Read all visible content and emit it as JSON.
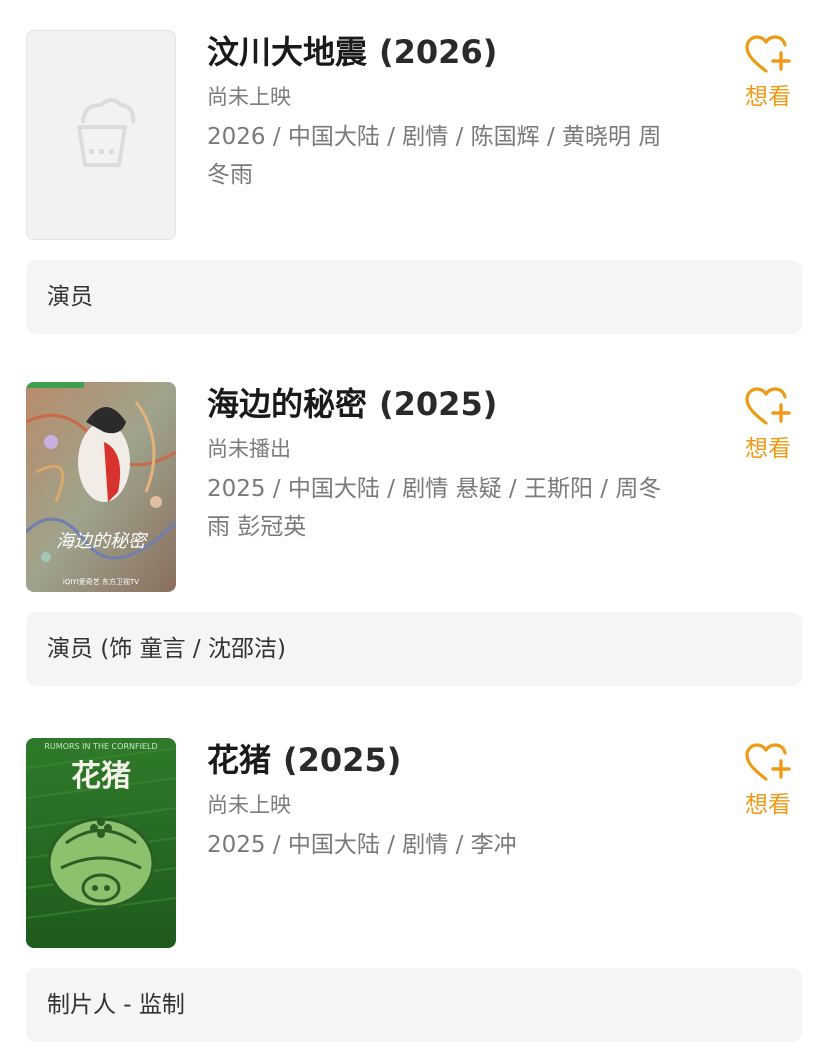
{
  "movies": [
    {
      "title": "汶川大地震",
      "year": "(2026)",
      "status": "尚未上映",
      "meta": "2026 / 中国大陆 / 剧情 / 陈国辉 / 黄晓明 周冬雨",
      "want_label": "想看",
      "role": "演员"
    },
    {
      "title": "海边的秘密",
      "year": "(2025)",
      "status": "尚未播出",
      "meta": "2025 / 中国大陆 / 剧情 悬疑 / 王斯阳 / 周冬雨 彭冠英",
      "want_label": "想看",
      "role": "演员 (饰 童言 / 沈邵洁)",
      "poster_text": "海边的秘密",
      "poster_logos": "iQIYI爱奇艺  东方卫视TV"
    },
    {
      "title": "花猪",
      "year": "(2025)",
      "status": "尚未上映",
      "meta": "2025 / 中国大陆 / 剧情 / 李冲",
      "want_label": "想看",
      "role": "制片人 - 监制",
      "poster_text": "花猪",
      "poster_subtitle": "RUMORS IN THE CORNFIELD"
    }
  ],
  "colors": {
    "accent": "#ef9a16",
    "card_bg": "#f5f5f5",
    "title": "#1a1a1a",
    "meta": "#7a7a7a"
  },
  "icons": {
    "want": "heart-plus-icon",
    "placeholder": "popcorn-icon"
  }
}
